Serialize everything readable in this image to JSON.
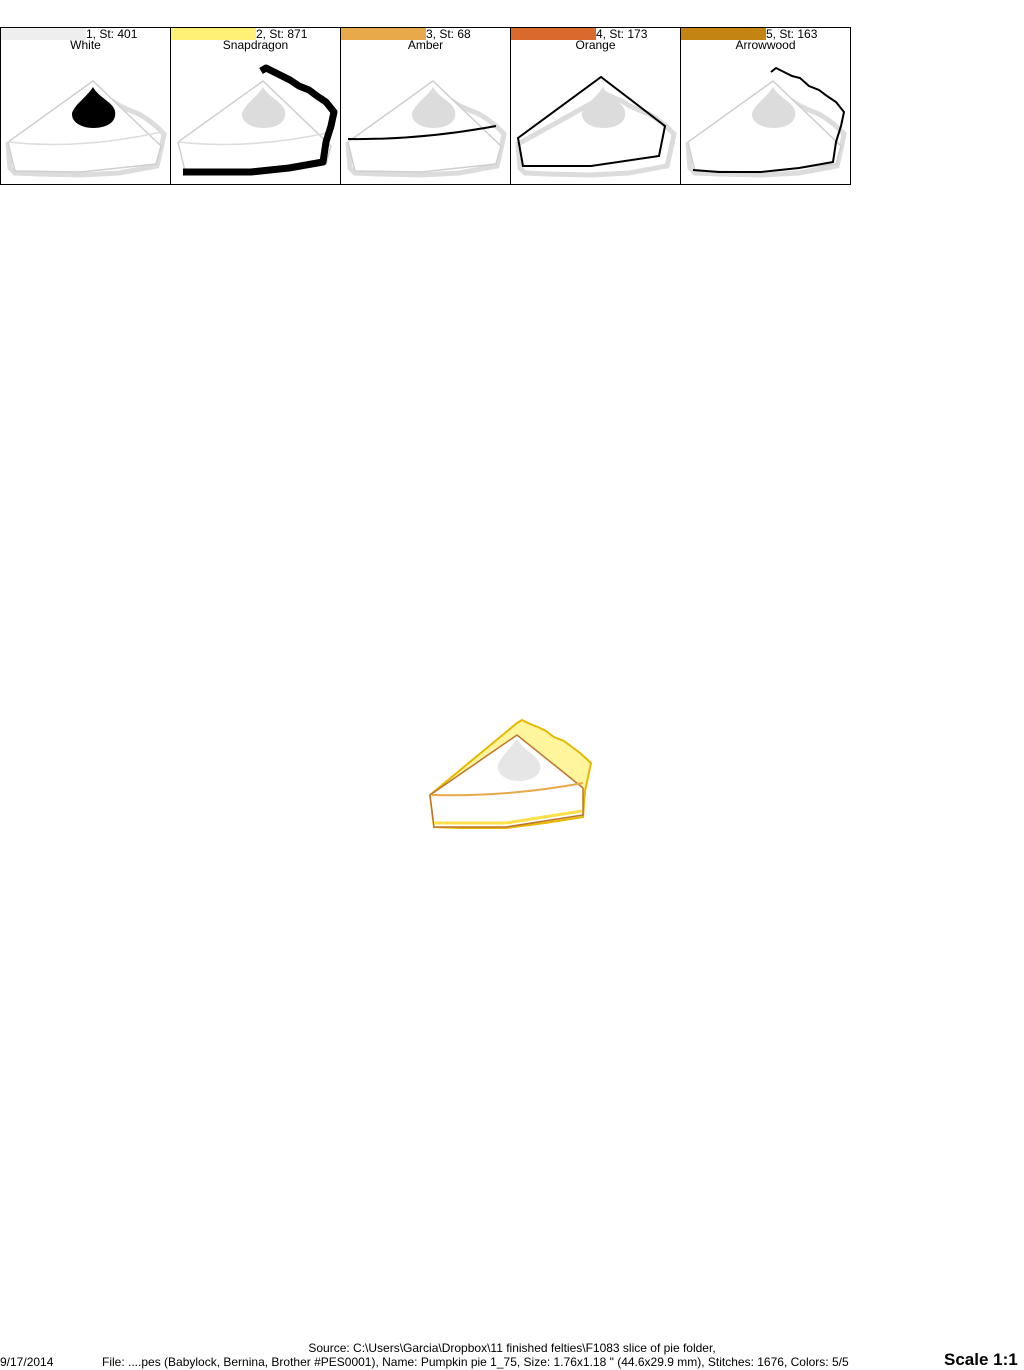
{
  "threads": [
    {
      "label": "1, St: 401",
      "name": "White",
      "color": "#eeeeee",
      "highlight": "whip"
    },
    {
      "label": "2, St: 871",
      "name": "Snapdragon",
      "color": "#fff176",
      "highlight": "crust-edge"
    },
    {
      "label": "3, St: 68",
      "name": "Amber",
      "color": "#e8a94a",
      "highlight": "top-line"
    },
    {
      "label": "4, St: 173",
      "name": "Orange",
      "color": "#d96a2b",
      "highlight": "outline"
    },
    {
      "label": "5, St: 163",
      "name": "Arrowwood",
      "color": "#c48412",
      "highlight": "crust-outline"
    }
  ],
  "footer": {
    "source": "Source: C:\\Users\\Garcia\\Dropbox\\11 finished felties\\F1083 slice of pie folder,",
    "date": "9/17/2014",
    "file": "File: ....pes (Babylock, Bernina, Brother #PES0001), Name: Pumpkin pie 1_75, Size: 1.76x1.18 \" (44.6x29.9 mm), Stitches: 1676, Colors: 5/5",
    "scale": "Scale 1:1"
  }
}
